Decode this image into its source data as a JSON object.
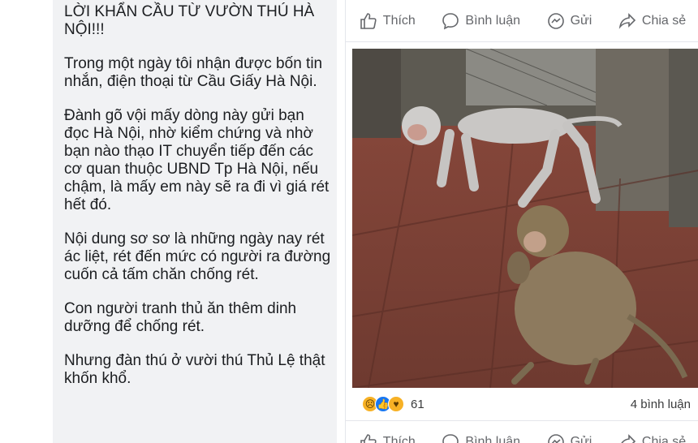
{
  "post": {
    "paragraphs": [
      "LỜI KHẨN CẦU TỪ VƯỜN THÚ HÀ NỘI!!!",
      "Trong một ngày tôi nhận được bốn tin nhắn, điện thoại từ Cầu Giấy Hà Nội.",
      "Đành gõ vội mấy dòng này gửi bạn đọc Hà Nội, nhờ kiểm chứng và  nhờ bạn nào thạo IT chuyển tiếp đến các cơ quan thuộc  UBND Tp Hà Nội, nếu chậm, là mấy em này sẽ ra đi vì giá rét hết đó.",
      "Nội dung sơ sơ là những ngày nay rét ác liệt, rét đến mức có người ra đường cuốn cả tấm chăn chống rét.",
      "Con người tranh thủ  ăn thêm dinh dưỡng để chống rét.",
      "Nhưng đàn thú ở vười thú Thủ Lệ thật khốn khổ."
    ]
  },
  "actions": {
    "like": "Thích",
    "comment": "Bình luận",
    "send": "Gửi",
    "share": "Chia sẻ"
  },
  "reactions": {
    "icons": [
      "sad-icon",
      "like-icon",
      "care-icon"
    ],
    "count": "61",
    "comments": "4 bình luận"
  },
  "colors": {
    "panel_bg": "#f1f2f4",
    "action_text": "#65676b",
    "like_blue": "#1877f2"
  }
}
